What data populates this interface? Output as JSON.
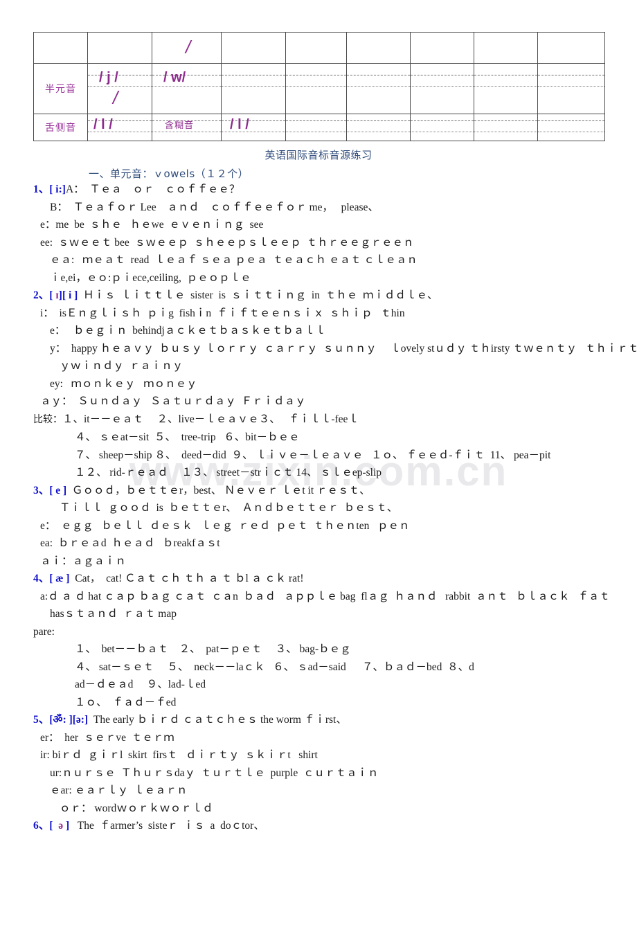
{
  "watermark": "www.zixin.com.cn",
  "colors": {
    "purple": "#993399",
    "blue": "#1111CC",
    "title_blue": "#2E4B7A",
    "table_border": "#4A4A4A"
  },
  "table": {
    "columns": 9,
    "rows": [
      {
        "name": "row-empty",
        "label": "",
        "cells": [
          "",
          "",
          "/",
          "",
          "",
          "",
          "",
          "",
          ""
        ]
      },
      {
        "name": "row-semivowel",
        "label": "半元音",
        "cells": [
          "半元音",
          "/  j  /",
          "/ w/",
          "",
          "",
          "",
          "",
          "",
          ""
        ]
      },
      {
        "name": "row-lateral",
        "label": "舌侧音",
        "cells": [
          "舌侧音",
          "/ l /",
          "含糊音",
          "/ l /",
          "",
          "",
          "",
          "",
          ""
        ]
      }
    ]
  },
  "document": {
    "title": "英语国际音标音源练习",
    "section_heading": "一、单元音：ｖowels（１２个）"
  },
  "lines": [
    {
      "id": "l1",
      "indent": 0,
      "num": "1、",
      "ipa": "[ i:]",
      "ipa_color": "blue",
      "text": "A：  Ｔｅａ　ｏｒ　ｃｏｆｆｅｅ？"
    },
    {
      "id": "l2",
      "indent": 2,
      "text": "B：  Ｔｅａｆｏｒ Lee　ａｎｄ　ｃｏｆｆｅｅｆｏｒ me，   please、"
    },
    {
      "id": "l3",
      "indent": 1,
      "text": "e：me  be  ｓｈｅ   ｈｅwe  ｅｖｅｎｉｎｇ  see"
    },
    {
      "id": "l4",
      "indent": 1,
      "text": "ee:  ｓｗｅｅｔ bee  ｓｗｅｅｐ  ｓｈｅｅｐｓｌｅｅｐ  ｔｈｒｅｅｇｒｅｅｎ"
    },
    {
      "id": "l5",
      "indent": 2,
      "text": "ｅａ:   ｍｅａｔ  read  ｌｅａｆ ｓｅａ ｐｅａ  ｔｅａｃｈ ｅａｔ ｃｌｅａｎ"
    },
    {
      "id": "l6",
      "indent": 2,
      "text": "ｉe,ei，ｅｏ:ｐｉece,ceiling,  ｐｅｏｐｌｅ"
    },
    {
      "id": "l7",
      "indent": 0,
      "num": "2、",
      "ipa_parts": [
        {
          "text": "[ ",
          "color": "blue"
        },
        {
          "text": "ɪ",
          "color": "purple"
        },
        {
          "text": "][ i ]",
          "color": "blue"
        }
      ],
      "text": "  Ｈｉｓ  ｌｉｔｔｌｅ  sister  is  ｓｉｔｔｉｎｇ  in  ｔｈｅ  ｍｉｄｄｌｅ、"
    },
    {
      "id": "l8",
      "indent": 1,
      "text": "i：  isＥｎｇｌｉｓｈ  ｐｉg  fishｉn  ｆｉｆｔｅｅｎｓｉｘ  ｓｈｉｐ   ｔhin"
    },
    {
      "id": "l9",
      "indent": 2,
      "text": "e：   ｂｅｇｉｎ  behindjａｃｋｅｔｂａｓｋｅｔｂａｌｌ"
    },
    {
      "id": "l10",
      "indent": 2,
      "text": "y：  happy ｈｅａｖｙ  ｂｕｓｙ ｌｏｒｒｙ  ｃａｒｒｙ  ｓｕｎｎｙ     ｌovely stｕｄｙ ｔｈirsty ｔｗｅｎｔｙ   ｔｈｉｒｔ"
    },
    {
      "id": "l11",
      "indent": 3,
      "text": "ｙｗｉｎｄｙ  ｒａｉｎｙ"
    },
    {
      "id": "l12",
      "indent": 2,
      "text": "ey:   ｍｏｎｋｅｙ   ｍｏｎｅｙ"
    },
    {
      "id": "l13",
      "indent": 1,
      "text": "ａｙ：  Ｓｕｎｄａｙ   Ｓａｔｕｒｄａｙ  Ｆｒｉｄａｙ"
    },
    {
      "id": "l14",
      "indent": 0,
      "cn_lead": "比较：",
      "text": "１、it－－ｅａｔ     ２、live－ｌｅａｖｅ３、   ｆｉｌｌ-feeｌ"
    },
    {
      "id": "l15",
      "indent": 4,
      "text": "４、 ｓｅat－sit  ５、  tree-trip   ６、bit－ｂｅｅ"
    },
    {
      "id": "l16",
      "indent": 4,
      "text": "７、 sheep－ship ８、  deed－did  ９、 ｌｉｖｅ－ｌｅａｖｅ   １ｏ、 ｆｅｅｄ-ｆｉｔ  11、 pea－pit"
    },
    {
      "id": "l17",
      "indent": 4,
      "text": "１２、 rid-ｒｅａｄ     １３、 street－strｉｃｔ 14、 ｓｌｅep-slip"
    },
    {
      "id": "l18",
      "indent": 0,
      "num": "3、",
      "ipa": "[ e ]",
      "ipa_color": "blue",
      "text": "  Ｇｏｏｄ，ｂｅｔｔｅr，best、 Ｎｅｖｅｒ ｌｅt it ｒｅｓｔ、"
    },
    {
      "id": "l19",
      "indent": 3,
      "text": "Ｔｉｌｌ  ｇｏｏｄ  is  ｂｅｔｔｅr、  Ａｎｄｂｅｔｔｅｒ  ｂｅｓｔ、"
    },
    {
      "id": "l20",
      "indent": 1,
      "text": "e：  ｅｇｇ   ｂｅｌｌ  ｄｅｓｋ   ｌｅｇ  ｒｅｄ  ｐｅｔ  ｔｈｅｎten   ｐｅｎ"
    },
    {
      "id": "l21",
      "indent": 1,
      "text": "ea:  ｂｒｅａd  ｈｅａｄ   ｂreakfａｓt"
    },
    {
      "id": "l22",
      "indent": 1,
      "text": "ａｉ：ａｇａｉｎ"
    },
    {
      "id": "l23",
      "indent": 0,
      "num": "4、",
      "ipa": "[ æ ]",
      "ipa_color": "blue",
      "text": "  Cat，  cat! Ｃａｔ ｃｈ ｔｈ ａ ｔ ｂl ａ ｃｋ rat!"
    },
    {
      "id": "l24",
      "indent": 1,
      "text": "a:ｄ ａ ｄ hat ｃａｐ ｂａｇ ｃａｔ  ｃａn  ｂａｄ   ａｐｐｌｅ bag  flａｇ  ｈａｎｄ   rabbit  ａｎｔ   ｂｌａｃｋ   ｆａｔ"
    },
    {
      "id": "l25",
      "indent": 2,
      "text": "hasｓｔａｎｄ  ｒａｔ map"
    },
    {
      "id": "l26",
      "indent": 0,
      "text": "pare:"
    },
    {
      "id": "l27",
      "indent": 4,
      "text": "１、  bet－－ｂａｔ    ２、  pat－ｐｅｔ     ３、 bag-ｂｅｇ"
    },
    {
      "id": "l28",
      "indent": 4,
      "text": "４、 sat－ｓｅｔ     ５、  neck－－laｃｋ   ６、 ｓad－said      ７、ｂａｄ－bed  ８、d"
    },
    {
      "id": "l29",
      "indent": 4,
      "text": "ad－ｄｅａd     ９、lad-ｌed"
    },
    {
      "id": "l30",
      "indent": 4,
      "text": "１ｏ、  ｆａｄ－ｆed"
    },
    {
      "id": "l31",
      "indent": 0,
      "num": "5、",
      "ipa_parts": [
        {
          "text": "[ॐ: ]",
          "color": "blue"
        },
        {
          "text": "[ə:]",
          "color": "blue"
        }
      ],
      "text": "  The early ｂｉｒｄ ｃａｔｃｈｅｓ the worm ｆｉrst、"
    },
    {
      "id": "l32",
      "indent": 1,
      "text": "er：  her  ｓｅｒve  ｔｅｒｍ"
    },
    {
      "id": "l33",
      "indent": 1,
      "text": "ir: biｒｄ  ｇｉｒl  skirt  firsｔ   ｄｉｒｔｙ  ｓｋｉｒt   shirt"
    },
    {
      "id": "l34",
      "indent": 2,
      "text": "ur:ｎｕｒｓｅ  Ｔｈｕｒｓdaｙ  ｔｕｒｔｌｅ  purple  ｃｕｒｔａｉｎ"
    },
    {
      "id": "l35",
      "indent": 2,
      "text": "ｅar: ｅａｒｌｙ  ｌｅａｒｎ"
    },
    {
      "id": "l36",
      "indent": 3,
      "text": "ｏｒ： wordｗｏｒｋｗｏｒｌｄ"
    },
    {
      "id": "l37",
      "indent": 0,
      "num": "6、",
      "ipa_parts": [
        {
          "text": "[  ",
          "color": "blue"
        },
        {
          "text": "ə",
          "color": "purple"
        },
        {
          "text": " ]",
          "color": "blue"
        }
      ],
      "text": "   The  ｆarmer’s  sisteｒ  ｉｓ  a  doｃtor、"
    }
  ]
}
